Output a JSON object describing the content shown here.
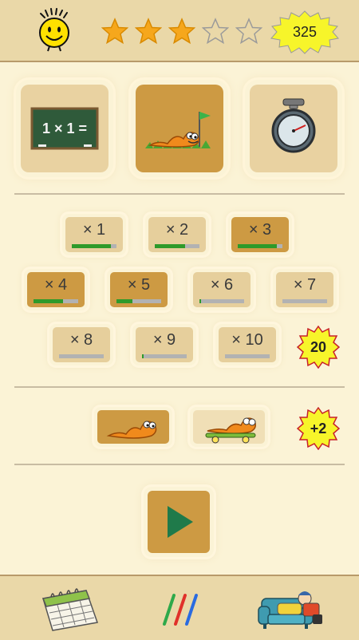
{
  "header": {
    "score": "325",
    "stars_total": 5,
    "stars_filled": 3,
    "colors": {
      "star_filled": "#f6a71c",
      "score_badge": "#f7f52a"
    }
  },
  "modes": [
    {
      "name": "multiplication-chalkboard",
      "board_text": "1 × 1 =",
      "selected": false
    },
    {
      "name": "worm-race",
      "selected": true
    },
    {
      "name": "stopwatch",
      "selected": false
    }
  ],
  "tables": [
    {
      "label": "× 1",
      "progress": 0.88,
      "selected": false
    },
    {
      "label": "× 2",
      "progress": 0.68,
      "selected": false
    },
    {
      "label": "× 3",
      "progress": 0.88,
      "selected": true
    },
    {
      "label": "× 4",
      "progress": 0.66,
      "selected": true
    },
    {
      "label": "× 5",
      "progress": 0.35,
      "selected": true
    },
    {
      "label": "× 6",
      "progress": 0.04,
      "selected": false
    },
    {
      "label": "× 7",
      "progress": 0.0,
      "selected": false
    },
    {
      "label": "× 8",
      "progress": 0.0,
      "selected": false
    },
    {
      "label": "× 9",
      "progress": 0.04,
      "selected": false
    },
    {
      "label": "× 10",
      "progress": 0.0,
      "selected": false
    }
  ],
  "tables_badge": "20",
  "worm_options": [
    {
      "name": "worm-plain",
      "selected": true
    },
    {
      "name": "worm-skateboard",
      "selected": false
    }
  ],
  "bonus_badge": "+2",
  "colors": {
    "background": "#fbf3d6",
    "bar_background": "#ead8a8",
    "tile_selected": "#cd9a43",
    "tile_unselected": "#e6cf9c",
    "progress_fill": "#2e9a2a",
    "progress_empty": "#b2b2b2",
    "play_triangle": "#1f7a4a"
  },
  "bottom_icons": [
    "calendar-icon",
    "crayons-icon",
    "couch-icon"
  ]
}
